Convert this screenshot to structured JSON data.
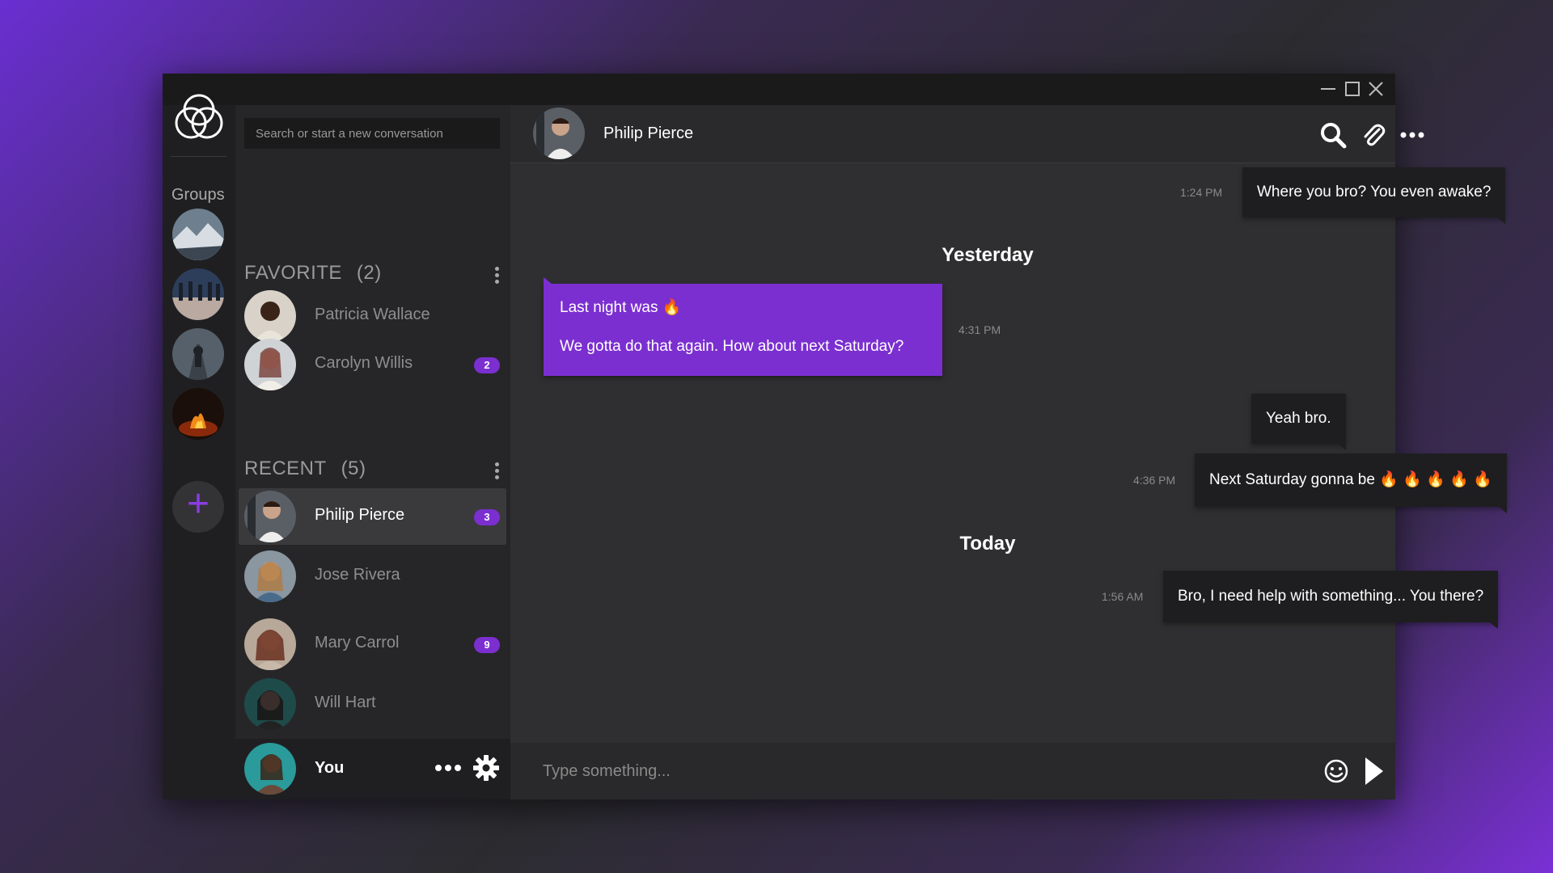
{
  "window": {
    "controls": {
      "minimize": "—",
      "maximize": "☐",
      "close": "✕"
    }
  },
  "groups": {
    "label": "Groups",
    "avatars": [
      "group-photo-mountains",
      "group-photo-crowd",
      "group-photo-road",
      "group-photo-fire"
    ],
    "add_icon": "+"
  },
  "contacts": {
    "search_placeholder": "Search or start a new conversation",
    "favorite": {
      "title": "FAVORITE",
      "count": "(2)",
      "items": [
        {
          "name": "Patricia Wallace",
          "badge": ""
        },
        {
          "name": "Carolyn Willis",
          "badge": "2"
        }
      ]
    },
    "recent": {
      "title": "RECENT",
      "count": "(5)",
      "items": [
        {
          "name": "Philip Pierce",
          "badge": "3",
          "active": true
        },
        {
          "name": "Jose Rivera",
          "badge": ""
        },
        {
          "name": "Mary Carrol",
          "badge": "9"
        },
        {
          "name": "Will Hart",
          "badge": ""
        }
      ]
    },
    "me": {
      "name": "You"
    }
  },
  "chat": {
    "title": "Philip Pierce",
    "messages": [
      {
        "time": "1:24 PM",
        "text": "Where you bro? You even awake?"
      },
      {
        "separator": "Yesterday"
      },
      {
        "time": "4:31 PM",
        "lines": [
          "Last night was 🔥",
          "We gotta do that again. How about next Saturday?"
        ]
      },
      {
        "text": "Yeah bro."
      },
      {
        "time": "4:36 PM",
        "text": "Next Saturday gonna be 🔥 🔥 🔥 🔥 🔥"
      },
      {
        "separator": "Today"
      },
      {
        "time": "1:56 AM",
        "text": "Bro, I need help with something... You there?"
      }
    ],
    "composer_placeholder": "Type something..."
  },
  "colors": {
    "accent": "#7b2fd0",
    "window_bg": "#2c2c2e",
    "sidebar_bg": "#1f1f21"
  }
}
